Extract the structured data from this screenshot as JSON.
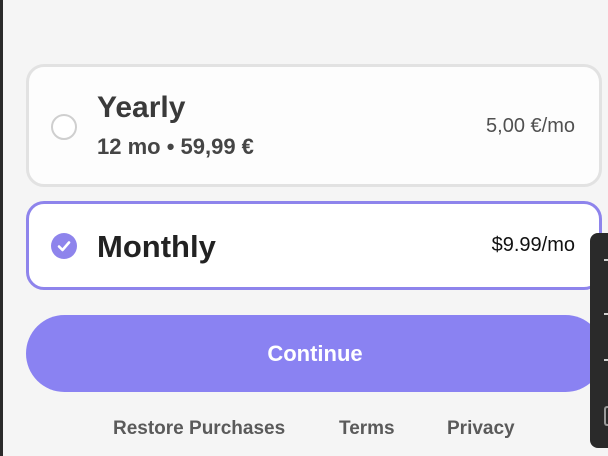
{
  "plans": {
    "yearly": {
      "title": "Yearly",
      "subtitle": "12 mo • 59,99 €",
      "price": "5,00 €/mo",
      "selected": false
    },
    "monthly": {
      "title": "Monthly",
      "price": "$9.99/mo",
      "selected": true
    }
  },
  "actions": {
    "continue_label": "Continue"
  },
  "footer": {
    "restore_label": "Restore Purchases",
    "terms_label": "Terms",
    "privacy_label": "Privacy"
  },
  "colors": {
    "accent": "#8a82f2",
    "selected_border": "#8e84ec",
    "unselected_border": "#e2e2e2",
    "background": "#f5f5f5"
  },
  "icons": {
    "radio_selected": "check-circle-icon",
    "radio_unselected": "radio-empty-icon"
  }
}
